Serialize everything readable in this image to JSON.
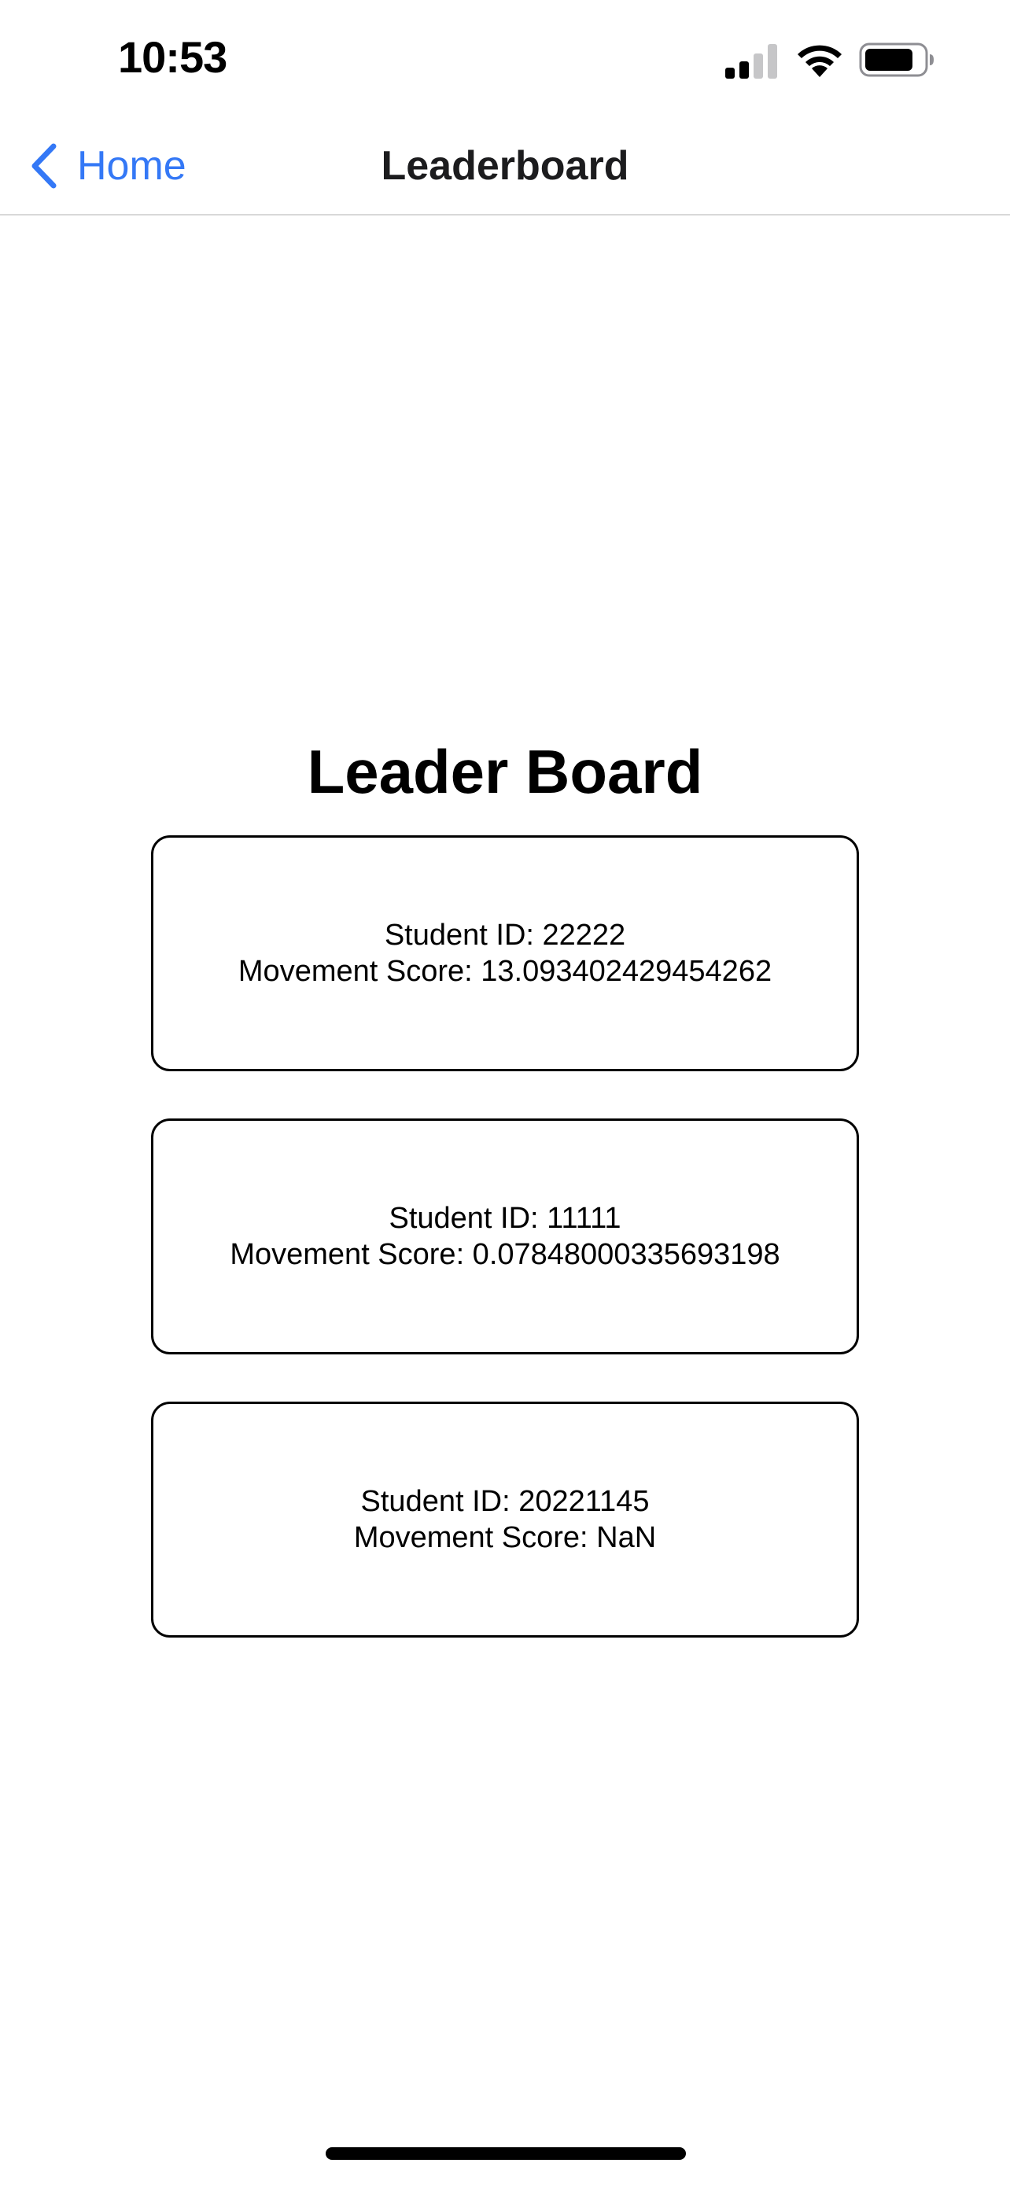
{
  "status_bar": {
    "time": "10:53",
    "icons": [
      "cellular-signal-icon",
      "wifi-icon",
      "battery-icon"
    ]
  },
  "nav": {
    "back_label": "Home",
    "back_icon": "chevron-left-icon",
    "title": "Leaderboard",
    "accent_color": "#3478f6"
  },
  "main": {
    "title": "Leader Board",
    "entries": [
      {
        "student_id": "Student ID: 22222",
        "score": "Movement Score: 13.093402429454262"
      },
      {
        "student_id": "Student ID: 11111",
        "score": "Movement Score: 0.07848000335693198"
      },
      {
        "student_id": "Student ID: 20221145",
        "score": "Movement Score: NaN"
      }
    ]
  }
}
